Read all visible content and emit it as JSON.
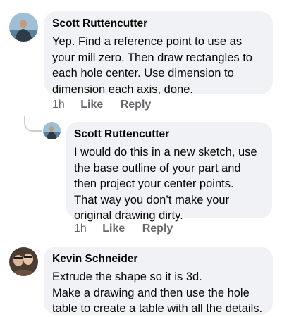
{
  "comments": [
    {
      "author": "Scott Ruttencutter",
      "text": "Yep. Find a reference point to use as\nyour mill zero.  Then draw rectangles to\neach hole center. Use dimension to\ndimension each axis, done.",
      "time": "1h",
      "like_label": "Like",
      "reply_label": "Reply"
    },
    {
      "author": "Scott Ruttencutter",
      "text": "I would do this in a new sketch, use\nthe base outline of your part and\nthen project your center points.\nThat way you don’t make your\noriginal drawing dirty.",
      "time": "1h",
      "like_label": "Like",
      "reply_label": "Reply"
    },
    {
      "author": "Kevin Schneider",
      "text": "Extrude the shape so it is 3d.\nMake a drawing and then use the hole\ntable to create a table with all the details."
    }
  ]
}
